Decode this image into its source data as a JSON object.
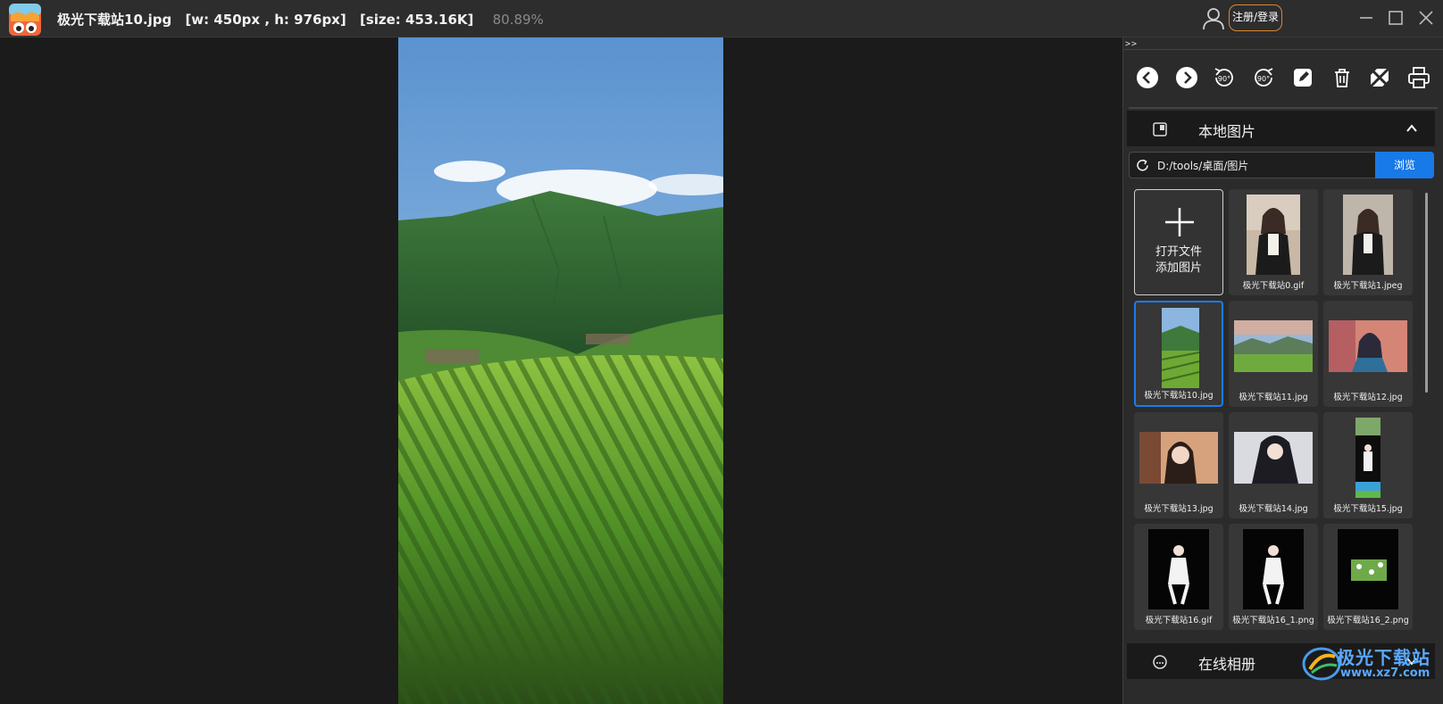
{
  "titlebar": {
    "filename": "极光下载站10.jpg",
    "dimensions": "[w: 450px , h: 976px]",
    "size": "[size: 453.16K]",
    "zoom": "80.89%",
    "login_label": "注册/登录"
  },
  "panel": {
    "collapse_label": ">>",
    "toolbar": [
      "prev-icon",
      "next-icon",
      "rotate-left-90-icon",
      "rotate-right-90-icon",
      "edit-icon",
      "delete-icon",
      "fit-icon",
      "print-icon"
    ],
    "local_section": {
      "label": "本地图片"
    },
    "path": {
      "value": "D:/tools/桌面/图片",
      "browse_label": "浏览"
    },
    "add_tile": {
      "line1": "打开文件",
      "line2": "添加图片"
    },
    "thumbnails": [
      {
        "name": "极光下载站0.gif"
      },
      {
        "name": "极光下载站1.jpeg"
      },
      {
        "name": "极光下载站10.jpg",
        "selected": true
      },
      {
        "name": "极光下载站11.jpg"
      },
      {
        "name": "极光下载站12.jpg"
      },
      {
        "name": "极光下载站13.jpg"
      },
      {
        "name": "极光下载站14.jpg"
      },
      {
        "name": "极光下载站15.jpg"
      },
      {
        "name": "极光下载站16.gif"
      },
      {
        "name": "极光下载站16_1.png"
      },
      {
        "name": "极光下载站16_2.png"
      }
    ],
    "online_section": {
      "label": "在线相册"
    }
  },
  "watermark": {
    "line1": "极光下载站",
    "line2": "www.xz7.com"
  },
  "colors": {
    "accent": "#1879e8",
    "login_border": "#d9892e",
    "background": "#1a1a1a"
  }
}
